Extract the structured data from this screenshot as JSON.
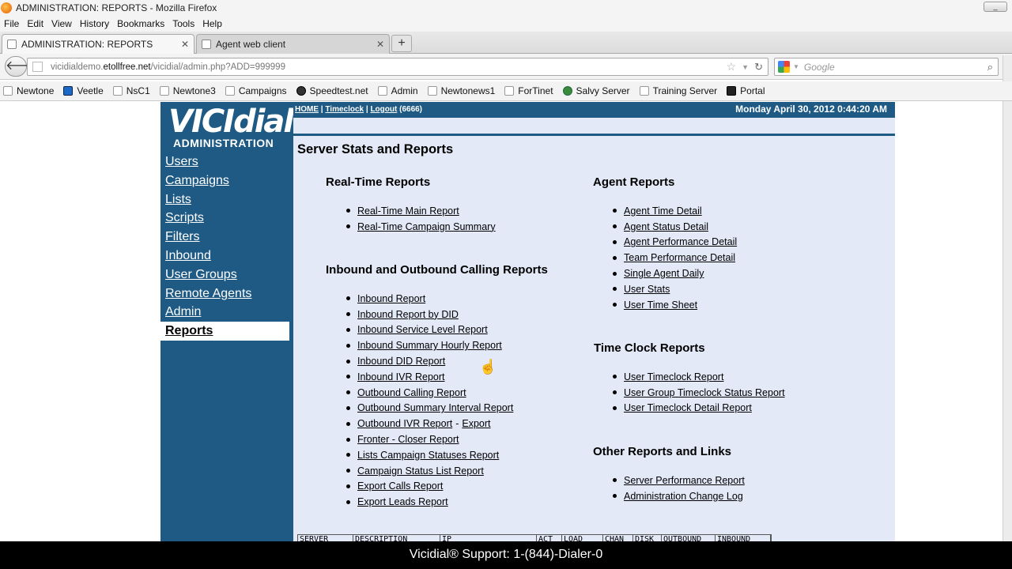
{
  "window": {
    "title": "ADMINISTRATION: REPORTS - Mozilla Firefox",
    "minimize_symbol": "_"
  },
  "menu": [
    "File",
    "Edit",
    "View",
    "History",
    "Bookmarks",
    "Tools",
    "Help"
  ],
  "tabs": [
    {
      "label": "ADMINISTRATION: REPORTS",
      "active": true
    },
    {
      "label": "Agent web client",
      "active": false
    }
  ],
  "newtab_symbol": "+",
  "address": {
    "host_prefix": "vicidialdemo.",
    "host": "etollfree.net",
    "path": "/vicidial/admin.php?ADD=999999"
  },
  "search": {
    "placeholder": "Google"
  },
  "bookmarks": [
    {
      "label": "Newtone",
      "icon": "page-icon"
    },
    {
      "label": "Veetle",
      "icon": "veetle-icon"
    },
    {
      "label": "NsC1",
      "icon": "page-icon"
    },
    {
      "label": "Newtone3",
      "icon": "page-icon"
    },
    {
      "label": "Campaigns",
      "icon": "page-icon"
    },
    {
      "label": "Speedtest.net",
      "icon": "speedtest-icon"
    },
    {
      "label": "Admin",
      "icon": "page-icon"
    },
    {
      "label": "Newtonews1",
      "icon": "page-icon"
    },
    {
      "label": "ForTinet",
      "icon": "page-icon"
    },
    {
      "label": "Salvy Server",
      "icon": "globe-icon"
    },
    {
      "label": "Training Server",
      "icon": "page-icon"
    },
    {
      "label": "Portal",
      "icon": "portal-icon"
    }
  ],
  "logo": {
    "main": "VICIdial",
    "sub": "ADMINISTRATION"
  },
  "sidebar": {
    "items": [
      {
        "label": "Users"
      },
      {
        "label": "Campaigns"
      },
      {
        "label": "Lists"
      },
      {
        "label": "Scripts"
      },
      {
        "label": "Filters"
      },
      {
        "label": "Inbound"
      },
      {
        "label": "User Groups"
      },
      {
        "label": "Remote Agents"
      },
      {
        "label": "Admin"
      },
      {
        "label": "Reports",
        "active": true
      }
    ]
  },
  "header": {
    "home": "HOME",
    "timeclock": "Timeclock",
    "logout": "Logout",
    "user_id": "(6666)",
    "datetime": "Monday April 30, 2012 0:44:20 AM"
  },
  "main": {
    "title": "Server Stats and Reports",
    "realtime": {
      "heading": "Real-Time Reports",
      "links": [
        "Real-Time Main Report",
        "Real-Time Campaign Summary"
      ]
    },
    "inout": {
      "heading": "Inbound and Outbound Calling Reports",
      "links": [
        "Inbound Report",
        "Inbound Report by DID",
        "Inbound Service Level Report",
        "Inbound Summary Hourly Report",
        "Inbound DID Report",
        "Inbound IVR Report",
        "Outbound Calling Report",
        "Outbound Summary Interval Report",
        "Outbound IVR Report",
        "Fronter - Closer Report",
        "Lists Campaign Statuses Report",
        "Campaign Status List Report",
        "Export Calls Report",
        "Export Leads Report"
      ],
      "ivr_export": "Export"
    },
    "agent": {
      "heading": "Agent Reports",
      "links": [
        "Agent Time Detail",
        "Agent Status Detail",
        "Agent Performance Detail",
        "Team Performance Detail",
        "Single Agent Daily",
        "User Stats",
        "User Time Sheet"
      ]
    },
    "timeclock": {
      "heading": "Time Clock Reports",
      "links": [
        "User Timeclock Report",
        "User Group Timeclock Status Report",
        "User Timeclock Detail Report"
      ]
    },
    "other": {
      "heading": "Other Reports and Links",
      "links": [
        "Server Performance Report",
        "Administration Change Log"
      ]
    },
    "table_headers": [
      "SERVER",
      "DESCRIPTION",
      "IP",
      "ACT",
      "LOAD",
      "CHAN",
      "DISK",
      "OUTBOUND",
      "INBOUND"
    ]
  },
  "support_bar": "Vicidial® Support: 1-(844)-Dialer-0"
}
